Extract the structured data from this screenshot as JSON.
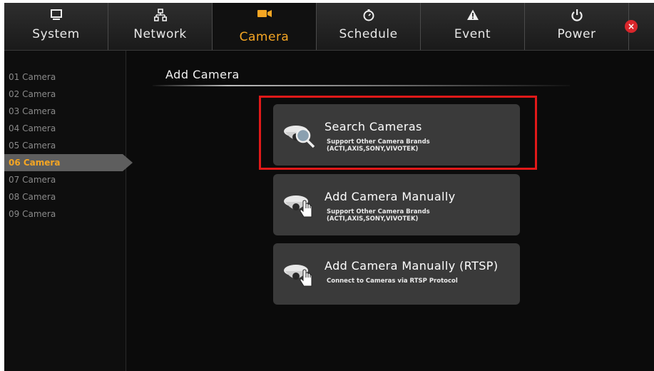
{
  "tabs": [
    {
      "label": "System",
      "icon": "monitor-icon"
    },
    {
      "label": "Network",
      "icon": "network-icon"
    },
    {
      "label": "Camera",
      "icon": "camera-icon",
      "active": true
    },
    {
      "label": "Schedule",
      "icon": "clock-icon"
    },
    {
      "label": "Event",
      "icon": "alert-icon"
    },
    {
      "label": "Power",
      "icon": "power-icon"
    }
  ],
  "close_icon": "close-icon",
  "accent_color": "#f5a623",
  "highlight_color": "#e11919",
  "sidebar": {
    "items": [
      "01 Camera",
      "02 Camera",
      "03 Camera",
      "04 Camera",
      "05 Camera",
      "06 Camera",
      "07 Camera",
      "08 Camera",
      "09 Camera"
    ],
    "selected": "06 Camera"
  },
  "main": {
    "title": "Add Camera",
    "actions": [
      {
        "title": "Search Cameras",
        "sub1": "Support Other Camera Brands",
        "sub2": "(ACTI,AXIS,SONY,VIVOTEK)",
        "icon": "camera-search-icon"
      },
      {
        "title": "Add Camera Manually",
        "sub1": "Support Other Camera Brands",
        "sub2": "(ACTI,AXIS,SONY,VIVOTEK)",
        "icon": "camera-hand-icon"
      },
      {
        "title": "Add Camera Manually (RTSP)",
        "sub1": "Connect to Cameras via RTSP Protocol",
        "sub2": "",
        "icon": "camera-hand-icon"
      }
    ]
  }
}
